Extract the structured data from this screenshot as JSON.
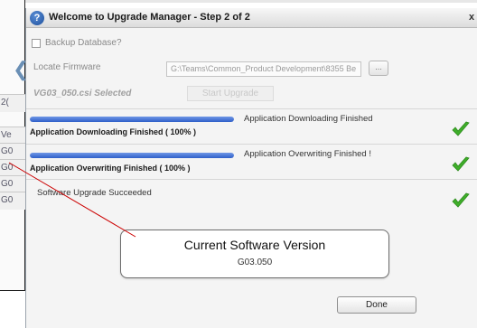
{
  "background": {
    "tabs": [
      "2(",
      "Ve",
      "G0",
      "G0",
      "G0",
      "G0"
    ]
  },
  "dialog": {
    "title": "Welcome to Upgrade Manager - Step 2 of 2",
    "close_label": "x",
    "help_icon_glyph": "?",
    "backup_label": "Backup Database?",
    "backup_checked": false,
    "locate_label": "Locate Firmware",
    "firmware_path": "G:\\Teams\\Common_Product Development\\8355 Be",
    "browse_label": "...",
    "selected_file": "VG03_050.csi Selected",
    "start_button": "Start Upgrade",
    "steps": [
      {
        "progress": 1.0,
        "status_right": "Application Downloading Finished",
        "status_left": "Application Downloading Finished  ( 100% )"
      },
      {
        "progress": 1.0,
        "status_right": "Application Overwriting Finished !",
        "status_left": "Application Overwriting Finished  ( 100% )"
      }
    ],
    "success_text": "Software Upgrade Succeeded",
    "version_title": "Current Software Version",
    "version_value": "G03.050",
    "done_button": "Done"
  },
  "colors": {
    "progress_fill": "#2e5fc9",
    "check_green": "#3fae2a",
    "annotation_line": "#cc0000"
  }
}
